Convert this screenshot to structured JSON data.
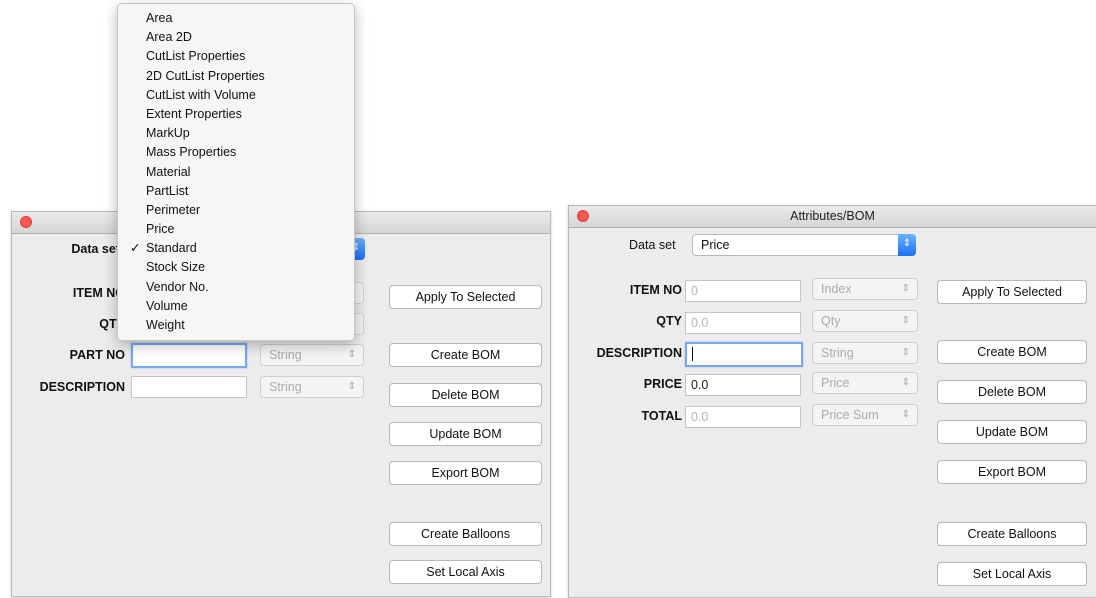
{
  "menu": {
    "items": [
      {
        "label": "Area",
        "checked": false
      },
      {
        "label": "Area 2D",
        "checked": false
      },
      {
        "label": "CutList Properties",
        "checked": false
      },
      {
        "label": "2D CutList Properties",
        "checked": false
      },
      {
        "label": "CutList with Volume",
        "checked": false
      },
      {
        "label": "Extent Properties",
        "checked": false
      },
      {
        "label": "MarkUp",
        "checked": false
      },
      {
        "label": "Mass Properties",
        "checked": false
      },
      {
        "label": "Material",
        "checked": false
      },
      {
        "label": "PartList",
        "checked": false
      },
      {
        "label": "Perimeter",
        "checked": false
      },
      {
        "label": "Price",
        "checked": false
      },
      {
        "label": "Standard",
        "checked": true
      },
      {
        "label": "Stock Size",
        "checked": false
      },
      {
        "label": "Vendor No.",
        "checked": false
      },
      {
        "label": "Volume",
        "checked": false
      },
      {
        "label": "Weight",
        "checked": false
      }
    ],
    "check_mark": "✓"
  },
  "left": {
    "title": "",
    "dataset_label": "Data set",
    "rows": [
      {
        "label": "ITEM NO"
      },
      {
        "label": "QTY"
      },
      {
        "label": "PART NO",
        "value": "",
        "type": "String"
      },
      {
        "label": "DESCRIPTION",
        "value": "",
        "type": "String"
      }
    ],
    "buttons": [
      "Apply To Selected",
      "Create BOM",
      "Delete BOM",
      "Update BOM",
      "Export BOM",
      "Create Balloons",
      "Set Local Axis"
    ]
  },
  "right": {
    "title": "Attributes/BOM",
    "dataset_label": "Data set",
    "dataset_value": "Price",
    "rows": [
      {
        "label": "ITEM NO",
        "value": "0",
        "type": "Index"
      },
      {
        "label": "QTY",
        "value": "0.0",
        "type": "Qty"
      },
      {
        "label": "DESCRIPTION",
        "value": "",
        "type": "String"
      },
      {
        "label": "PRICE",
        "value": "0.0",
        "type": "Price"
      },
      {
        "label": "TOTAL",
        "value": "0.0",
        "type": "Price Sum"
      }
    ],
    "buttons": [
      "Apply To Selected",
      "Create BOM",
      "Delete BOM",
      "Update BOM",
      "Export BOM",
      "Create Balloons",
      "Set Local Axis"
    ]
  },
  "colors": {
    "close": "#fc5753",
    "focus": "#78a8e8",
    "stepper": "#1a6ff5"
  },
  "icons": {
    "close": "close-icon",
    "stepper": "chevron-updown-icon"
  }
}
